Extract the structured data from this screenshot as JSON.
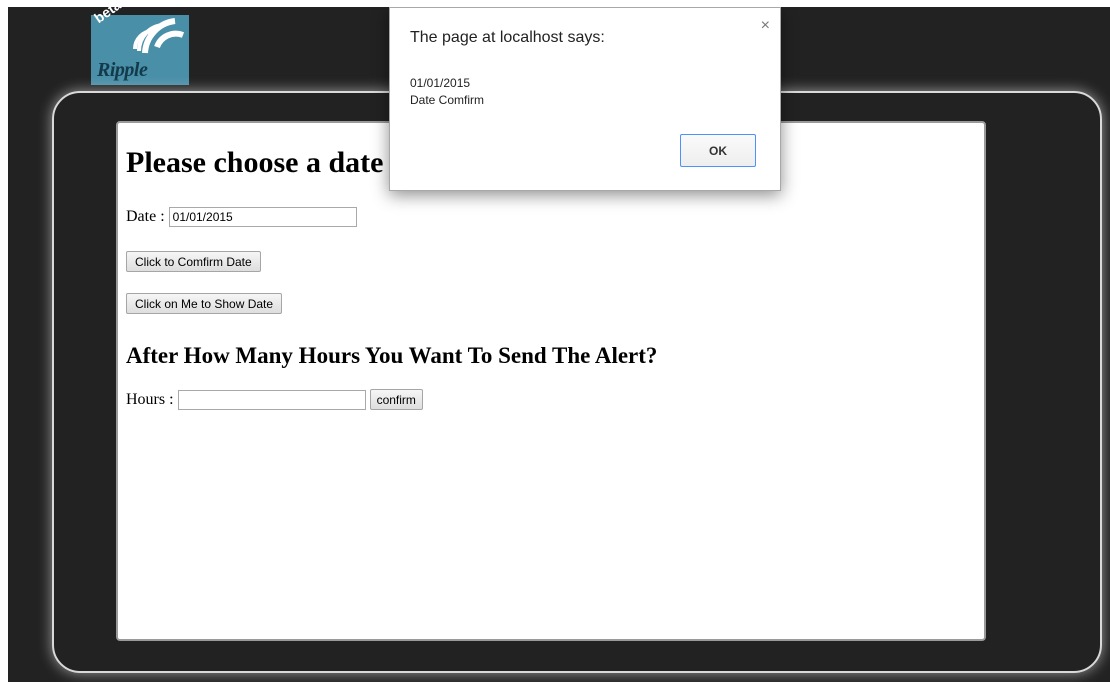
{
  "logo": {
    "beta": "beta",
    "word": "Ripple",
    "color": "#4a8fa8"
  },
  "page": {
    "heading": "Please choose a date",
    "date_label": "Date :",
    "date_value": "01/01/2015",
    "confirm_date_button": "Click to Comfirm Date",
    "show_date_button": "Click on Me to Show Date",
    "hours_heading": "After How Many Hours You Want To Send The Alert?",
    "hours_label": "Hours :",
    "hours_value": "",
    "hours_confirm_button": "confirm"
  },
  "dialog": {
    "title": "The page at localhost says:",
    "close": "×",
    "message_line1": "01/01/2015",
    "message_line2": "Date Comfirm",
    "ok_label": "OK"
  }
}
